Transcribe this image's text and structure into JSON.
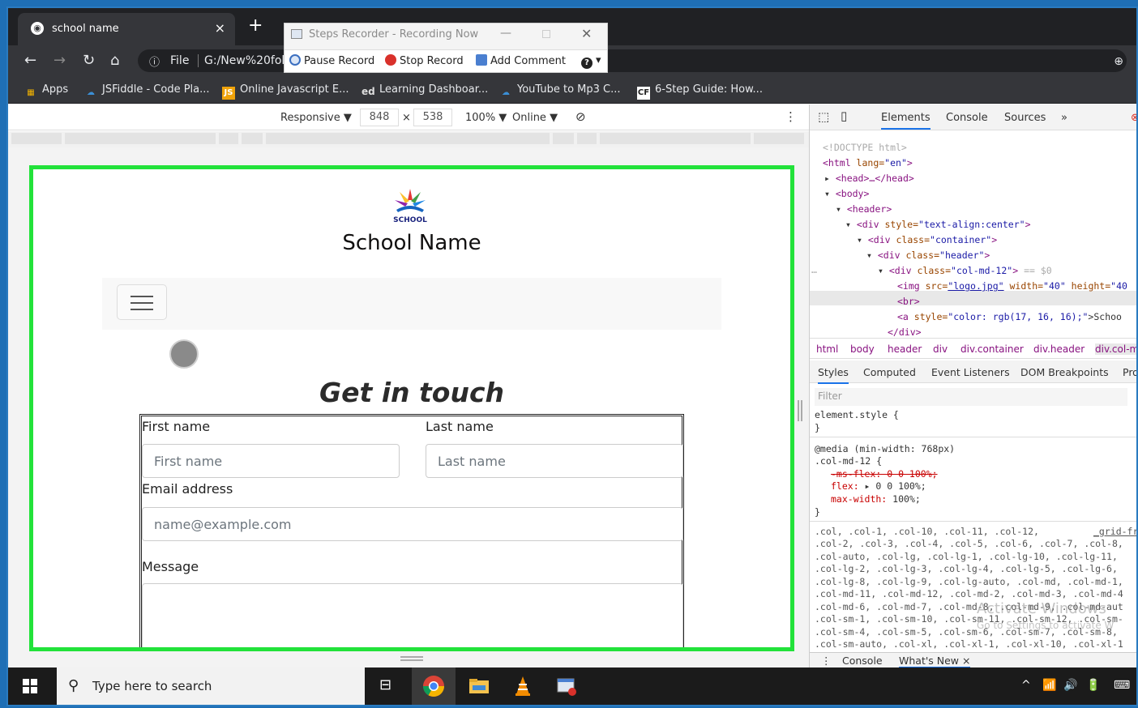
{
  "browser": {
    "tab_title": "school name",
    "tab_close": "×",
    "new_tab": "+",
    "omnibox_info": "ⓘ",
    "omnibox_scheme": "File",
    "omnibox_url": "G:/New%20fol",
    "bookmarks": [
      {
        "label": "Apps",
        "icon": "apps-grid-icon"
      },
      {
        "label": "JSFiddle - Code Pla...",
        "icon": "jsfiddle-icon"
      },
      {
        "label": "Online Javascript E...",
        "icon": "js-icon"
      },
      {
        "label": "Learning Dashboar...",
        "icon": "ed-icon"
      },
      {
        "label": "YouTube to Mp3 C...",
        "icon": "download-icon"
      },
      {
        "label": "6-Step Guide: How...",
        "icon": "cf-icon"
      }
    ],
    "bookmark_icon_text": {
      "js": "JS",
      "ed": "ed",
      "cf": "CF"
    }
  },
  "steps_recorder": {
    "title": "Steps Recorder - Recording Now",
    "pause": "Pause Record",
    "stop": "Stop Record",
    "comment": "Add Comment",
    "help": "?"
  },
  "device_toolbar": {
    "mode": "Responsive ▼",
    "width": "848",
    "times": "×",
    "height": "538",
    "zoom": "100% ▼",
    "network": "Online ▼",
    "more": "⋮"
  },
  "page": {
    "logo_text": "SCHOOL",
    "school_name": "School Name",
    "heading": "Get in touch",
    "form": {
      "first_name_label": "First name",
      "first_name_placeholder": "First name",
      "last_name_label": "Last name",
      "last_name_placeholder": "Last name",
      "email_label": "Email address",
      "email_placeholder": "name@example.com",
      "message_label": "Message"
    }
  },
  "devtools": {
    "tabs": [
      "Elements",
      "Console",
      "Sources",
      "»"
    ],
    "dom": {
      "doctype": "<!DOCTYPE html>",
      "html_open": "<html",
      "html_lang_attr": " lang=",
      "html_lang_val": "\"en\"",
      "html_close": ">",
      "head": "<head>…</head>",
      "body": "<body>",
      "header": "<header>",
      "div1_open": "<div",
      "div1_attr": " style=",
      "div1_val": "\"text-align:center\"",
      "div2_attr": " class=",
      "div2_val": "\"container\"",
      "div3_val": "\"header\"",
      "div4_val": "\"col-md-12\"",
      "selected_marker": " == $0",
      "img_open": "<img",
      "img_src_attr": " src=",
      "img_src_val": "\"logo.jpg\"",
      "img_w_attr": " width=",
      "img_w_val": "\"40\"",
      "img_h_attr": " height=",
      "img_h_val": "\"40",
      "br": "<br>",
      "a_open": "<a",
      "a_style_attr": " style=",
      "a_style_val": "\"color: rgb(17, 16, 16);\"",
      "a_text": ">Schoo",
      "div_close": "</div>",
      "gt": ">",
      "ellipsis": "…"
    },
    "breadcrumbs": [
      "html",
      "body",
      "header",
      "div",
      "div.container",
      "div.header",
      "div.col-m"
    ],
    "sub_tabs": [
      "Styles",
      "Computed",
      "Event Listeners",
      "DOM Breakpoints",
      "Pro"
    ],
    "filter_placeholder": "Filter",
    "styles": {
      "element_style": "element.style {",
      "close_brace": "}",
      "media": "@media (min-width: 768px)",
      "selector": ".col-md-12 {",
      "ms_flex": "-ms-flex: 0 0 100%;",
      "flex_prop": "flex:",
      "flex_val": " ▸ 0 0 100%;",
      "max_width_prop": "max-width:",
      "max_width_val": " 100%;",
      "grid_link": "_grid-fr",
      "selector_list": [
        ".col, .col-1, .col-10, .col-11, .col-12,",
        ".col-2, .col-3, .col-4, .col-5, .col-6, .col-7, .col-8,",
        ".col-auto, .col-lg, .col-lg-1, .col-lg-10, .col-lg-11,",
        ".col-lg-2, .col-lg-3, .col-lg-4, .col-lg-5, .col-lg-6,",
        ".col-lg-8, .col-lg-9, .col-lg-auto, .col-md, .col-md-1,",
        ".col-md-11, .col-md-12, .col-md-2, .col-md-3, .col-md-4",
        ".col-md-6, .col-md-7, .col-md-8, .col-md-9, .col-md-aut",
        ".col-sm-1, .col-sm-10, .col-sm-11, .col-sm-12, .col-sm-",
        ".col-sm-4, .col-sm-5, .col-sm-6, .col-sm-7, .col-sm-8,",
        ".col-sm-auto, .col-xl, .col-xl-1, .col-xl-10, .col-xl-1"
      ]
    },
    "watermark_title": "Activate Windows",
    "watermark_sub": "Go to Settings to activate W",
    "drawer": {
      "console": "Console",
      "whats_new": "What's New ×",
      "more": "⋮"
    }
  },
  "taskbar": {
    "search_placeholder": "Type here to search",
    "tray": [
      "^",
      "📶",
      "🔊",
      "🔋",
      "⌨"
    ]
  },
  "colors": {
    "green_border": "#22e23a",
    "chrome_dark": "#202124",
    "chrome_tab": "#35363a",
    "taskbar": "#1b1b1b",
    "devtools_tag": "#881280",
    "devtools_attr": "#994500",
    "devtools_value": "#1a1aa6"
  }
}
